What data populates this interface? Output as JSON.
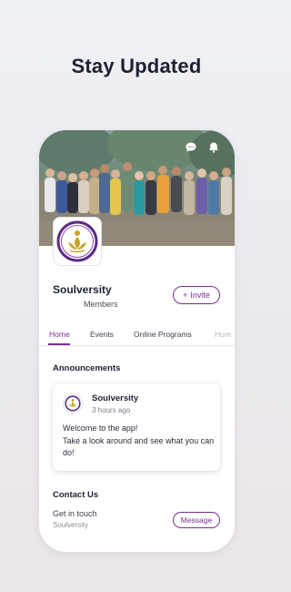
{
  "headline": "Stay Updated",
  "colors": {
    "accent": "#7b2f8e",
    "logo_gold": "#c9a227",
    "logo_ring": "#5c2a86"
  },
  "header": {
    "chat_icon": "chat-bubble-icon",
    "notifications_icon": "bell-icon"
  },
  "community": {
    "name": "Soulversity",
    "members_label": "Members",
    "invite_label": "Invite",
    "invite_icon": "+"
  },
  "tabs": [
    {
      "label": "Home",
      "active": true
    },
    {
      "label": "Events"
    },
    {
      "label": "Online Programs"
    },
    {
      "label": "Hum"
    }
  ],
  "announcements": {
    "title": "Announcements",
    "post": {
      "author": "Soulversity",
      "time": "3 hours ago",
      "body_line1": "Welcome to the app!",
      "body_line2": "Take a look around and see what you can do!"
    }
  },
  "contact": {
    "title": "Contact Us",
    "line1": "Get in touch",
    "line2": "Soulversity",
    "message_label": "Message"
  }
}
